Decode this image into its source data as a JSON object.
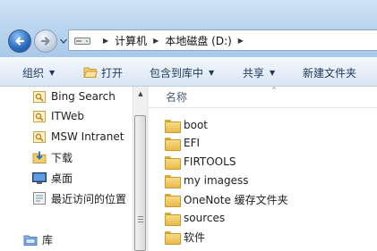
{
  "address": {
    "crumbs": [
      "计算机",
      "本地磁盘 (D:)"
    ]
  },
  "toolbar": {
    "organize": "组织",
    "open": "打开",
    "include_in_library": "包含到库中",
    "share": "共享",
    "new_folder": "新建文件夹"
  },
  "navigation": {
    "items": [
      {
        "label": "Bing Search",
        "icon": "favorite-link-icon"
      },
      {
        "label": "ITWeb",
        "icon": "favorite-link-icon"
      },
      {
        "label": "MSW Intranet",
        "icon": "favorite-link-icon"
      },
      {
        "label": "下载",
        "icon": "downloads-icon"
      },
      {
        "label": "桌面",
        "icon": "desktop-icon"
      },
      {
        "label": "最近访问的位置",
        "icon": "recent-places-icon"
      }
    ],
    "libraries": {
      "label": "库",
      "icon": "libraries-icon"
    }
  },
  "content": {
    "column_name": "名称",
    "files": [
      {
        "name": "boot",
        "type": "folder"
      },
      {
        "name": "EFI",
        "type": "folder"
      },
      {
        "name": "FIRTOOLS",
        "type": "folder"
      },
      {
        "name": "my imagess",
        "type": "folder"
      },
      {
        "name": "OneNote 缓存文件夹",
        "type": "folder"
      },
      {
        "name": "sources",
        "type": "folder"
      },
      {
        "name": "软件",
        "type": "folder"
      }
    ]
  },
  "colors": {
    "accent": "#2d6fc2",
    "toolbar_text": "#1e395b",
    "folder_yellow": "#e9b94b"
  }
}
